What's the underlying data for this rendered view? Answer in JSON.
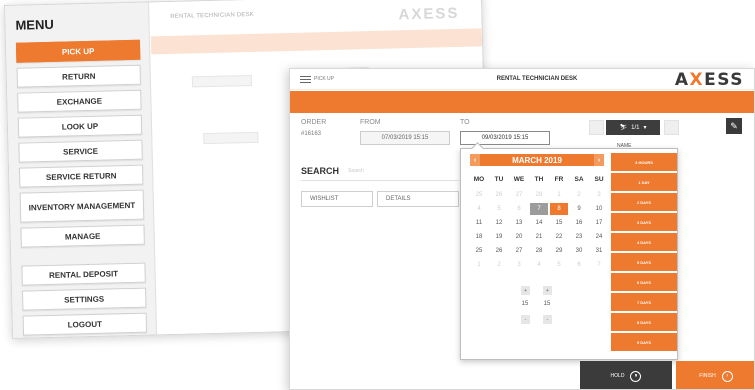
{
  "back_window": {
    "menu_title": "MENU",
    "menu_items": [
      {
        "label": "PICK UP",
        "active": true
      },
      {
        "label": "RETURN"
      },
      {
        "label": "EXCHANGE"
      },
      {
        "label": "LOOK UP"
      },
      {
        "label": "SERVICE"
      },
      {
        "label": "SERVICE RETURN"
      },
      {
        "label": "INVENTORY MANAGEMENT"
      },
      {
        "label": "MANAGE"
      },
      {
        "label": "RENTAL DEPOSIT"
      },
      {
        "label": "SETTINGS"
      },
      {
        "label": "LOGOUT"
      }
    ],
    "title": "RENTAL TECHNICIAN DESK",
    "logo": "AXESS"
  },
  "front_window": {
    "breadcrumb": "PICK UP",
    "title": "RENTAL TECHNICIAN DESK",
    "logo_left": "A",
    "logo_x": "X",
    "logo_right": "ESS",
    "order": {
      "label": "ORDER",
      "value": "#16163"
    },
    "from": {
      "label": "FROM",
      "value": "07/03/2019 15:15"
    },
    "to": {
      "label": "TO",
      "value": "09/03/2019 15:15"
    },
    "search": {
      "label": "SEARCH",
      "placeholder": "Search"
    },
    "tabs": [
      "WISHLIST",
      "DETAILS"
    ],
    "dropdown_value": "1/1",
    "name_label": "NAME",
    "calendar": {
      "month": "MARCH 2019",
      "prev": "‹",
      "next": "›",
      "weekdays": [
        "MO",
        "TU",
        "WE",
        "TH",
        "FR",
        "SA",
        "SU"
      ],
      "weeks": [
        [
          "25",
          "26",
          "27",
          "28",
          "1",
          "2",
          "3"
        ],
        [
          "4",
          "5",
          "6",
          "7",
          "8",
          "9",
          "10"
        ],
        [
          "11",
          "12",
          "13",
          "14",
          "15",
          "16",
          "17"
        ],
        [
          "18",
          "19",
          "20",
          "21",
          "22",
          "23",
          "24"
        ],
        [
          "25",
          "26",
          "27",
          "28",
          "29",
          "30",
          "31"
        ],
        [
          "1",
          "2",
          "3",
          "4",
          "5",
          "6",
          "7"
        ]
      ],
      "selected_start": "7",
      "selected_end": "8",
      "time": {
        "hour": "15",
        "minute": "15",
        "up": "+",
        "down": "-"
      },
      "durations": [
        "3 HOURS",
        "1 DAY",
        "2 DAYS",
        "3 DAYS",
        "4 DAYS",
        "5 DAYS",
        "6 DAYS",
        "7 DAYS",
        "8 DAYS",
        "9 DAYS"
      ]
    },
    "hold_label": "HOLD",
    "hold_icon": "pause-icon",
    "finish_label": "FINISH",
    "finish_icon": "arrow-right-icon",
    "accent": "#ee7a2f"
  }
}
